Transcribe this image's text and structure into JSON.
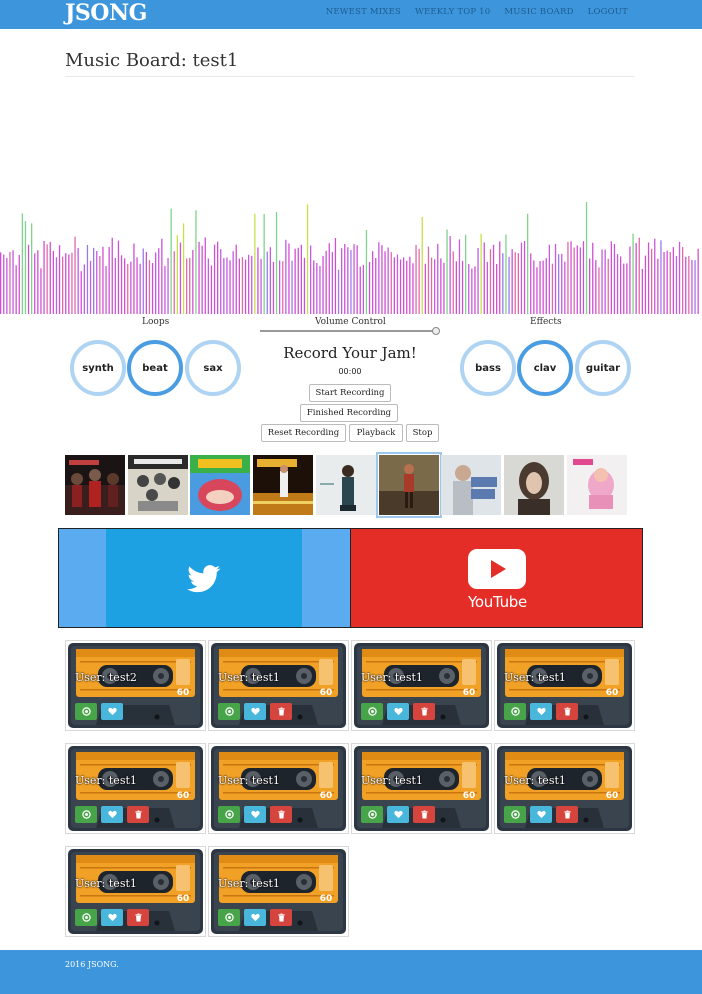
{
  "navbar": {
    "brand": "JSONG",
    "links": [
      "NEWEST MIXES",
      "WEEKLY TOP 10",
      "MUSIC BOARD",
      "LOGOUT"
    ]
  },
  "page": {
    "title": "Music Board: test1"
  },
  "loops": {
    "label": "Loops",
    "items": [
      "synth",
      "beat",
      "sax"
    ],
    "active": "beat"
  },
  "volume": {
    "label": "Volume Control",
    "level": 1.0
  },
  "effects": {
    "label": "Effects",
    "items": [
      "bass",
      "clav",
      "guitar"
    ],
    "active": "clav"
  },
  "recorder": {
    "title": "Record Your Jam!",
    "timer": "00:00",
    "buttons": {
      "start": "Start Recording",
      "finished": "Finished Recording",
      "reset": "Reset Recording",
      "playback": "Playback",
      "stop": "Stop"
    }
  },
  "albums": {
    "count": 9,
    "selected_index": 5,
    "icons": [
      "album-cover-thriller-icon",
      "album-cover-beatles-icon",
      "album-cover-basement-jaxx-icon",
      "album-cover-saturday-night-fever-icon",
      "album-cover-woman-icon",
      "album-cover-woman-red-icon",
      "album-cover-blue-jeans-icon",
      "album-cover-portrait-icon",
      "album-cover-kill-me-icon"
    ]
  },
  "share": {
    "twitter": {
      "icon": "twitter-bird-icon",
      "color": "#1da1e2"
    },
    "youtube": {
      "label": "YouTube",
      "icon": "youtube-play-icon",
      "color": "#e52d27"
    }
  },
  "mixes": {
    "user_prefix": "User:",
    "items": [
      {
        "user": "test2",
        "deletable": false
      },
      {
        "user": "test1",
        "deletable": true
      },
      {
        "user": "test1",
        "deletable": true
      },
      {
        "user": "test1",
        "deletable": true
      },
      {
        "user": "test1",
        "deletable": true
      },
      {
        "user": "test1",
        "deletable": true
      },
      {
        "user": "test1",
        "deletable": true
      },
      {
        "user": "test1",
        "deletable": true
      },
      {
        "user": "test1",
        "deletable": true
      },
      {
        "user": "test1",
        "deletable": true
      }
    ],
    "button_icons": [
      "play-icon",
      "heart-icon",
      "trash-icon"
    ]
  },
  "footer": {
    "text": "2016 JSONG."
  },
  "colors": {
    "brand": "#3d96dc",
    "circle_active": "#4a9de3",
    "circle_idle": "#aed3f3",
    "play": "#48a448",
    "like": "#49b6dc",
    "delete": "#d6443e"
  }
}
